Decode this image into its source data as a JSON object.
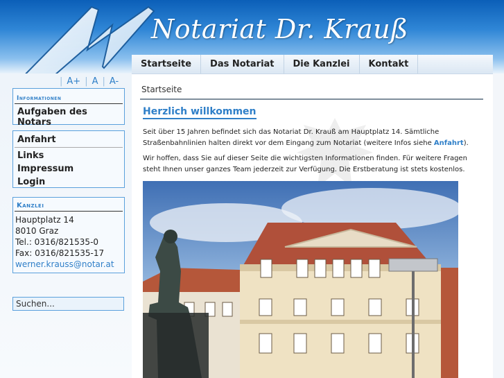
{
  "header": {
    "title": "Notariat Dr. Krauß"
  },
  "font_size": {
    "increase": "A+",
    "normal": "A",
    "decrease": "A-"
  },
  "nav": {
    "tabs": [
      "Startseite",
      "Das Notariat",
      "Die Kanzlei",
      "Kontakt"
    ]
  },
  "sidebar": {
    "info_title": "Informationen",
    "info_items": [
      "Aufgaben des Notars"
    ],
    "nav_items": [
      "Anfahrt",
      "Links",
      "Impressum",
      "Login"
    ],
    "kanzlei_title": "Kanzlei",
    "address": [
      "Hauptplatz 14",
      "8010 Graz",
      "Tel.: 0316/821535-0",
      "Fax: 0316/821535-17"
    ],
    "email": "werner.krauss@notar.at",
    "search_value": "Suchen..."
  },
  "main": {
    "breadcrumb": "Startseite",
    "title": "Herzlich willkommen",
    "para1_text": "Seit über 15 Jahren befindet sich das Notariat Dr. Krauß am Hauptplatz 14. Sämtliche Straßenbahnlinien halten direkt vor dem Eingang zum Notariat (weitere Infos siehe ",
    "para1_link": "Anfahrt",
    "para1_end": ").",
    "para2_text": "Wir hoffen, dass Sie auf dieser Seite die wichtigsten Informationen finden. Für weitere Fragen steht Ihnen unser ganzes Team jederzeit zur Verfügung. Die Erstberatung ist stets kostenlos."
  },
  "colors": {
    "accent": "#2f7fc8",
    "header_dark": "#0b5fb8",
    "border": "#5aa0dc"
  }
}
